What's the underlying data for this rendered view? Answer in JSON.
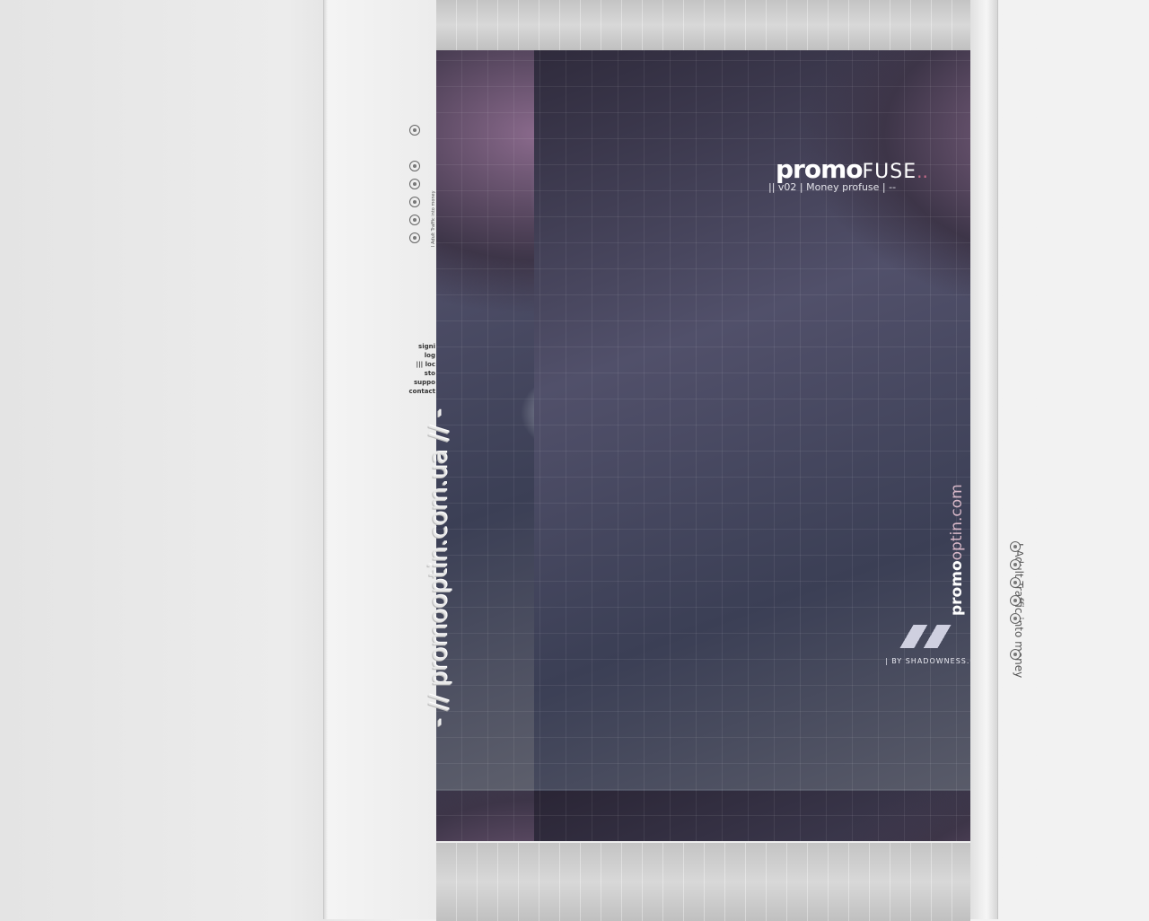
{
  "logo": {
    "main": "promo",
    "sub": "FUSE",
    "dots": ".."
  },
  "tagline": "|| v02  |  Money profuse  |  --",
  "vertical_url": {
    "bold": "promo",
    "light": "optin.com"
  },
  "credit": "| BY SHADOWNESS.COM |",
  "menu": [
    "signi",
    "log",
    "||| loc",
    "sto",
    "suppo",
    "contact"
  ],
  "left_url": "- // promooptin.com.ua // -",
  "left_tagline": "I Adult Traffic into money",
  "right_tagline": "I Adult Traffic into money",
  "icons": [
    "node-circle-icon"
  ]
}
